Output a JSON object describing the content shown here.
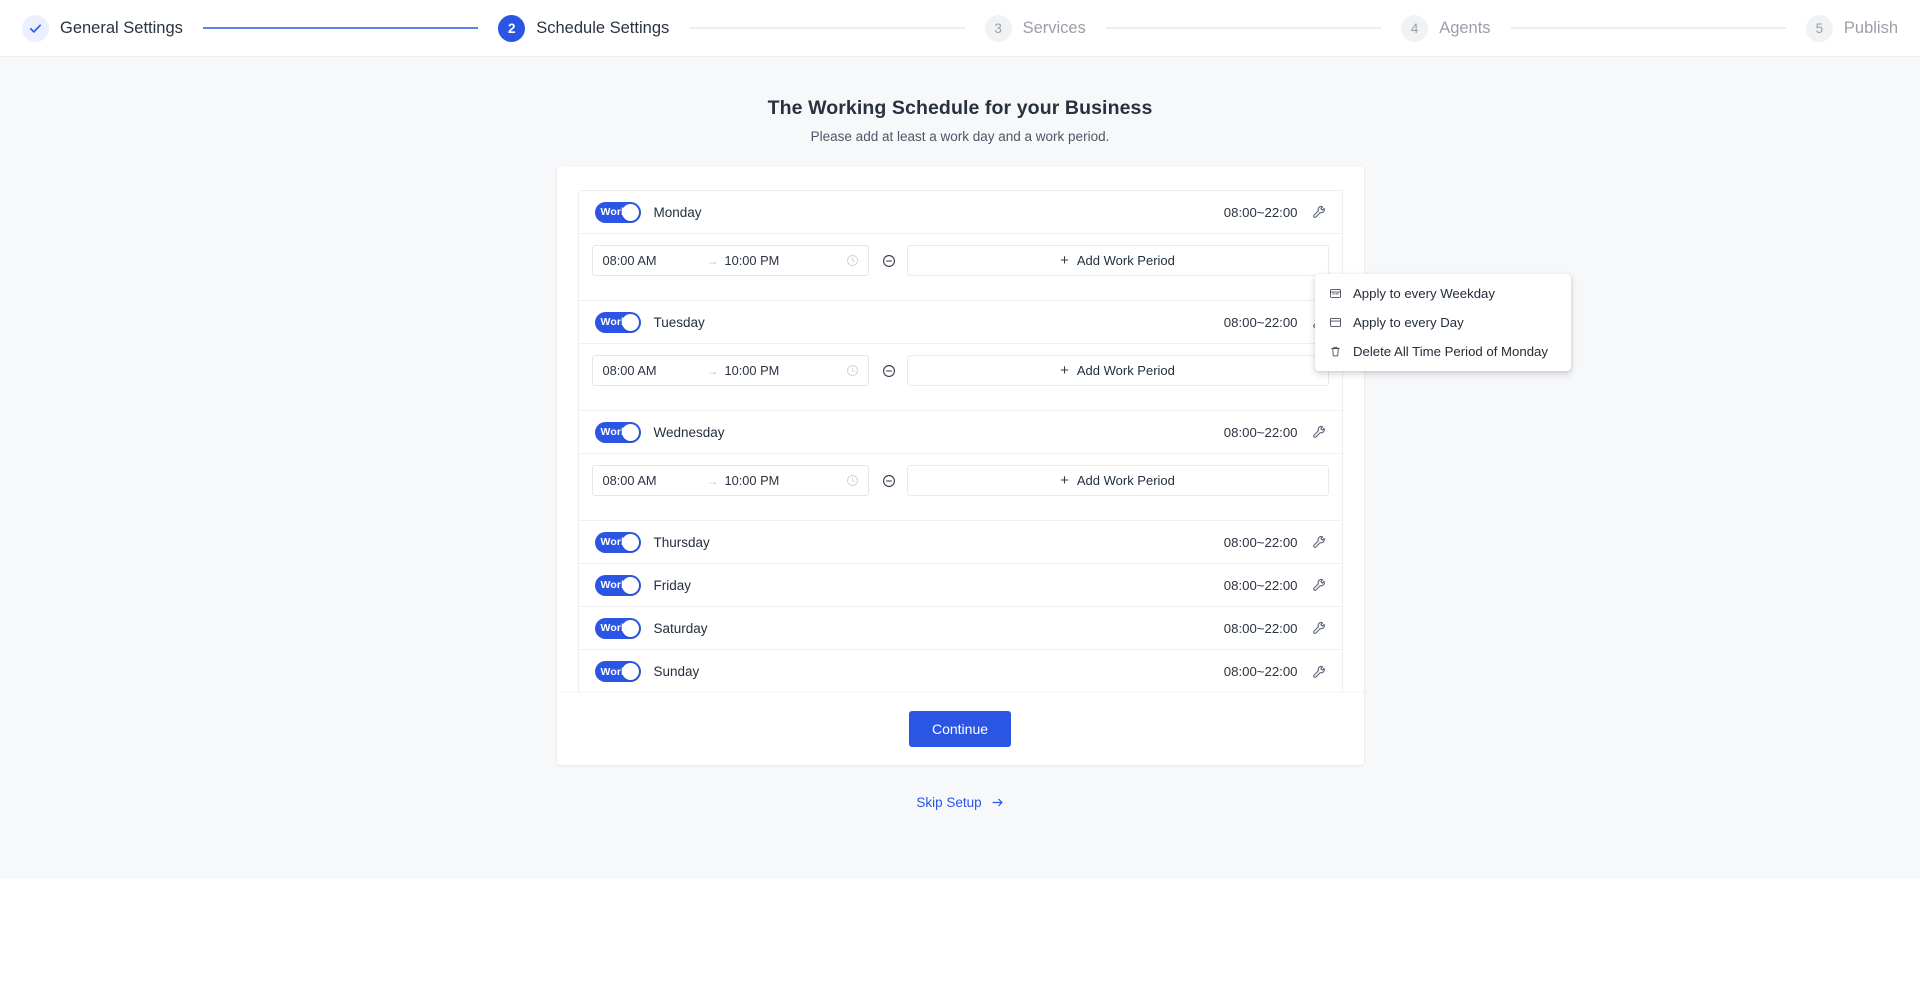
{
  "stepper": {
    "steps": [
      {
        "marker": "check-icon",
        "number": "",
        "label": "General Settings",
        "state": "done"
      },
      {
        "marker": "number",
        "number": "2",
        "label": "Schedule Settings",
        "state": "active"
      },
      {
        "marker": "number",
        "number": "3",
        "label": "Services",
        "state": "todo"
      },
      {
        "marker": "number",
        "number": "4",
        "label": "Agents",
        "state": "todo"
      },
      {
        "marker": "number",
        "number": "5",
        "label": "Publish",
        "state": "todo"
      }
    ]
  },
  "header": {
    "title": "The Working Schedule for your Business",
    "subtitle": "Please add at least a work day and a work period."
  },
  "schedule": {
    "toggle_label": "Work",
    "range_arrow": "→",
    "add_period_label": "Add Work Period",
    "add_period_plus": "+",
    "days": [
      {
        "name": "Monday",
        "summary": "08:00~22:00",
        "working": true,
        "expanded": true,
        "period": {
          "start": "08:00 AM",
          "end": "10:00 PM"
        }
      },
      {
        "name": "Tuesday",
        "summary": "08:00~22:00",
        "working": true,
        "expanded": true,
        "period": {
          "start": "08:00 AM",
          "end": "10:00 PM"
        }
      },
      {
        "name": "Wednesday",
        "summary": "08:00~22:00",
        "working": true,
        "expanded": true,
        "period": {
          "start": "08:00 AM",
          "end": "10:00 PM"
        }
      },
      {
        "name": "Thursday",
        "summary": "08:00~22:00",
        "working": true,
        "expanded": false
      },
      {
        "name": "Friday",
        "summary": "08:00~22:00",
        "working": true,
        "expanded": false
      },
      {
        "name": "Saturday",
        "summary": "08:00~22:00",
        "working": true,
        "expanded": false
      },
      {
        "name": "Sunday",
        "summary": "08:00~22:00",
        "working": true,
        "expanded": false
      }
    ]
  },
  "context_menu": {
    "open_for_day": "Monday",
    "items": [
      {
        "icon": "calendar-week-icon",
        "label": "Apply to every Weekday"
      },
      {
        "icon": "calendar-icon",
        "label": "Apply to every Day"
      },
      {
        "icon": "trash-icon",
        "label": "Delete All Time Period of Monday"
      }
    ]
  },
  "footer": {
    "continue_label": "Continue",
    "skip_label": "Skip Setup"
  },
  "colors": {
    "accent": "#2b56e4",
    "page_bg": "#f7f8fa",
    "card_bg": "#ffffff",
    "text": "#2a3342",
    "muted": "#9aa0a9"
  }
}
